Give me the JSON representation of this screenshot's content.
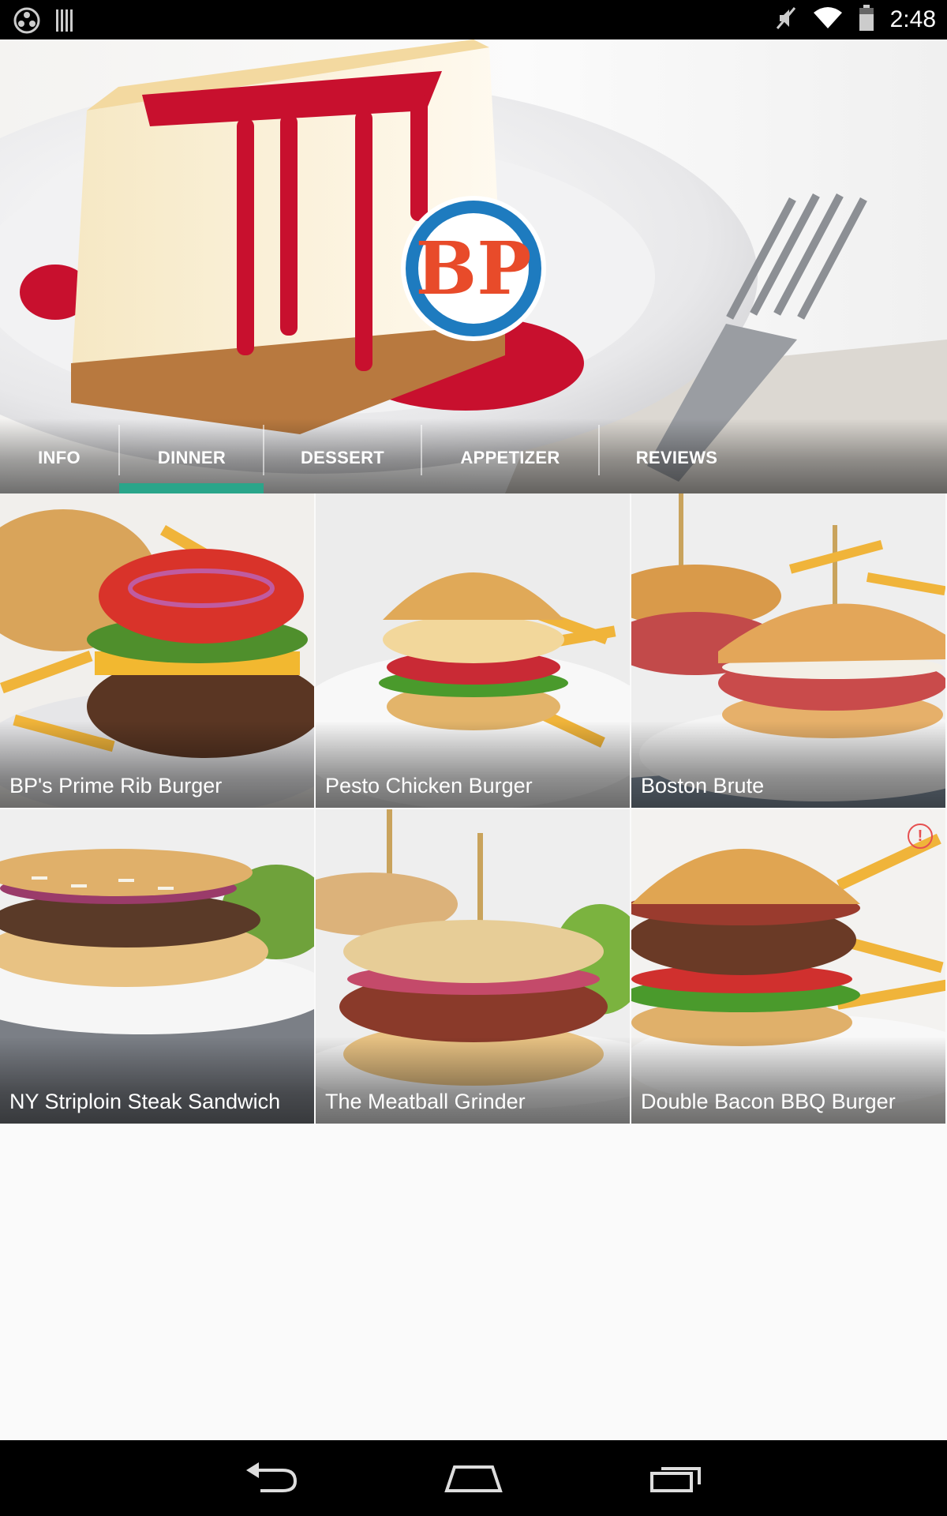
{
  "status_bar": {
    "time": "2:48",
    "icons": [
      "app-notification-icon",
      "barcode-icon",
      "mute-icon",
      "wifi-icon",
      "battery-icon"
    ]
  },
  "hero": {
    "logo_alt": "BP",
    "background": "cheesecake-with-raspberry-sauce"
  },
  "tabs": [
    {
      "label": "INFO",
      "selected": false
    },
    {
      "label": "DINNER",
      "selected": true
    },
    {
      "label": "DESSERT",
      "selected": false
    },
    {
      "label": "APPETIZER",
      "selected": false
    },
    {
      "label": "REVIEWS",
      "selected": false
    }
  ],
  "menu_items": [
    {
      "name": "BP's Prime Rib Burger",
      "image": "burger-with-fries"
    },
    {
      "name": "Pesto Chicken Burger",
      "image": "chicken-burger-with-fries"
    },
    {
      "name": "Boston Brute",
      "image": "deli-sandwich"
    },
    {
      "name": "NY Striploin Steak Sandwich",
      "image": "steak-sandwich"
    },
    {
      "name": "The Meatball Grinder",
      "image": "meatball-sub"
    },
    {
      "name": "Double Bacon BBQ Burger",
      "image": "bacon-burger-with-fries",
      "alert": "!"
    }
  ],
  "colors": {
    "accent": "#2aa58a",
    "logo_red": "#e84b2a",
    "logo_blue": "#1e7bbf",
    "alert": "#e65050"
  },
  "nav_bar": {
    "buttons": [
      "back-icon",
      "home-icon",
      "recent-apps-icon"
    ]
  }
}
